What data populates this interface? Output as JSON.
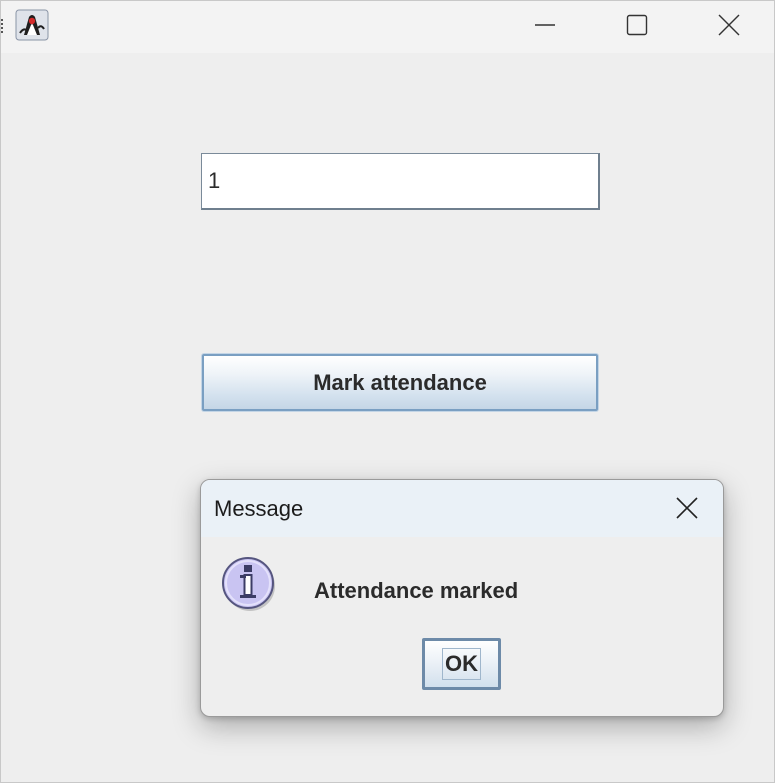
{
  "window": {
    "app_icon": "java-duke-icon",
    "controls": {
      "minimize_icon": "minimize-icon",
      "maximize_icon": "maximize-icon",
      "close_icon": "close-icon"
    }
  },
  "form": {
    "id_value": "1",
    "mark_button_label": "Mark attendance"
  },
  "dialog": {
    "title": "Message",
    "icon": "info-icon",
    "message": "Attendance marked",
    "ok_label": "OK",
    "close_icon": "close-icon"
  },
  "colors": {
    "window_bg": "#eeeeee",
    "titlebar_bg": "#f3f3f3",
    "dialog_titlebar_bg": "#eaf1f7",
    "button_border": "#7a9fc2",
    "info_icon_fill": "#c9c4f2"
  }
}
